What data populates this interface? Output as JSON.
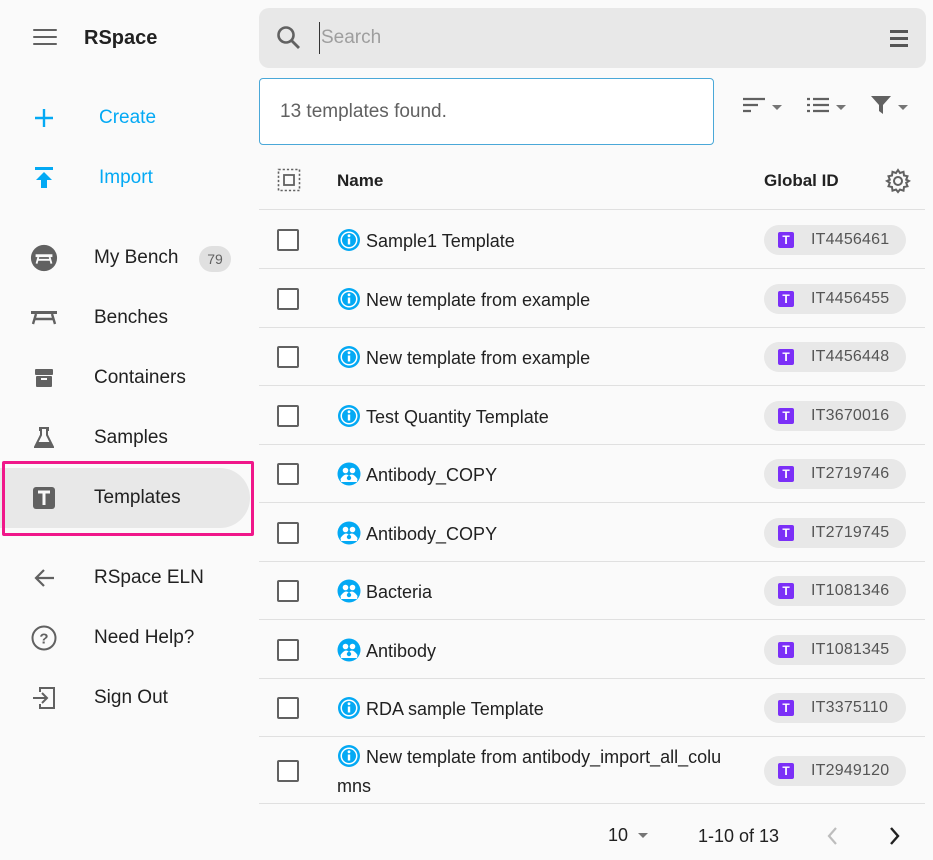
{
  "app": {
    "title": "RSpace"
  },
  "sidebar": {
    "create_label": "Create",
    "import_label": "Import",
    "items": [
      {
        "label": "My Bench",
        "badge": "79"
      },
      {
        "label": "Benches"
      },
      {
        "label": "Containers"
      },
      {
        "label": "Samples"
      },
      {
        "label": "Templates"
      },
      {
        "label": "RSpace ELN"
      },
      {
        "label": "Need Help?"
      },
      {
        "label": "Sign Out"
      }
    ]
  },
  "search": {
    "placeholder": "Search",
    "value": ""
  },
  "results": {
    "text": "13 templates found."
  },
  "table": {
    "headers": {
      "name": "Name",
      "global_id": "Global ID"
    },
    "rows": [
      {
        "name": "Sample1 Template",
        "icon": "info-icon",
        "global_id": "IT4456461"
      },
      {
        "name": "New template from example",
        "icon": "info-icon",
        "global_id": "IT4456455"
      },
      {
        "name": "New template from example",
        "icon": "info-icon",
        "global_id": "IT4456448"
      },
      {
        "name": "Test Quantity Template",
        "icon": "info-icon",
        "global_id": "IT3670016"
      },
      {
        "name": "Antibody_COPY",
        "icon": "shared-group-icon",
        "global_id": "IT2719746"
      },
      {
        "name": "Antibody_COPY",
        "icon": "shared-group-icon",
        "global_id": "IT2719745"
      },
      {
        "name": "Bacteria",
        "icon": "shared-group-icon",
        "global_id": "IT1081346"
      },
      {
        "name": "Antibody",
        "icon": "shared-group-icon",
        "global_id": "IT1081345"
      },
      {
        "name": "RDA sample Template",
        "icon": "info-icon",
        "global_id": "IT3375110"
      },
      {
        "name": "New template from antibody_import_all_columns",
        "icon": "info-icon",
        "global_id": "IT2949120"
      }
    ],
    "chip_letter": "T"
  },
  "pagination": {
    "page_size": "10",
    "range": "1-10 of 13"
  },
  "colors": {
    "accent": "#03a9f4",
    "highlight": "#f0178a",
    "template_chip": "#7b2ff7"
  }
}
